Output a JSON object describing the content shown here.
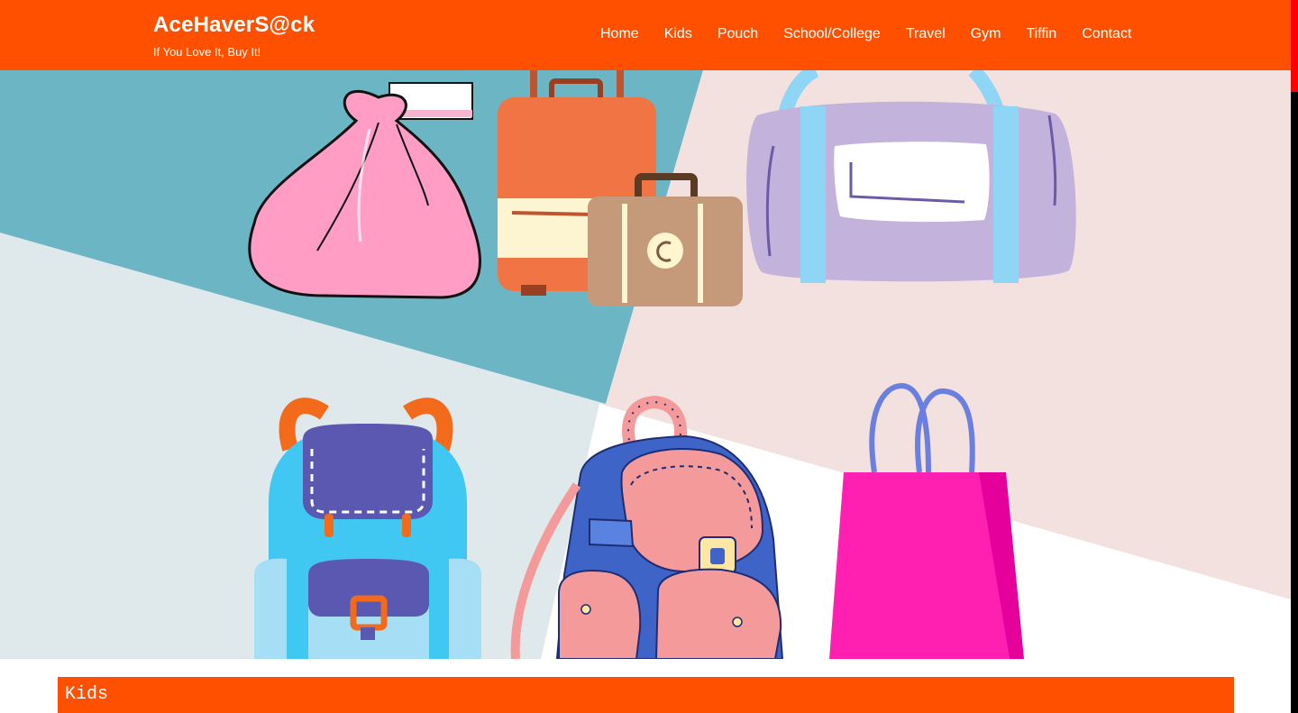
{
  "header": {
    "brand_title": "AceHaverS@ck",
    "brand_tagline": "If You Love It, Buy It!"
  },
  "nav": {
    "items": [
      "Home",
      "Kids",
      "Pouch",
      "School/College",
      "Travel",
      "Gym",
      "Tiffin",
      "Contact"
    ]
  },
  "hero": {
    "illustration": "collage of bags: pink drawstring sack, orange and beige suitcases, lavender duffel bag, blue backpack, pink and blue backpack, magenta shopping bag"
  },
  "section": {
    "title": "Kids"
  },
  "colors": {
    "brand_orange": "#ff5000",
    "teal": "#6cb5c4",
    "light_blue": "#dfe9ec",
    "blush": "#f2e1df"
  }
}
